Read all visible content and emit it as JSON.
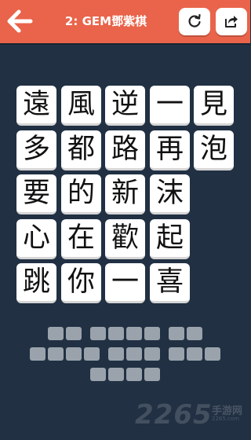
{
  "header": {
    "level_title": "2: GEM鄧紫棋",
    "back_icon": "arrow-left-icon",
    "refresh_icon": "refresh-icon",
    "share_icon": "share-icon"
  },
  "colors": {
    "header_bg": "#e9644a",
    "page_bg": "#213043",
    "tile_bg": "#ffffff",
    "slot_bg": "#9aa3ac"
  },
  "board": {
    "rows": [
      [
        "遠",
        "風",
        "逆",
        "一",
        "見"
      ],
      [
        "多",
        "都",
        "路",
        "再",
        "泡"
      ],
      [
        "要",
        "的",
        "新",
        "沫"
      ],
      [
        "心",
        "在",
        "歡",
        "起"
      ],
      [
        "跳",
        "你",
        "一",
        "喜"
      ]
    ]
  },
  "answer_slots": {
    "lines": [
      [
        2,
        4,
        2
      ],
      [
        4,
        3,
        3
      ],
      [
        4
      ]
    ]
  },
  "watermark": {
    "logo": "2265",
    "site": "手游网",
    "url": "2265.com"
  }
}
